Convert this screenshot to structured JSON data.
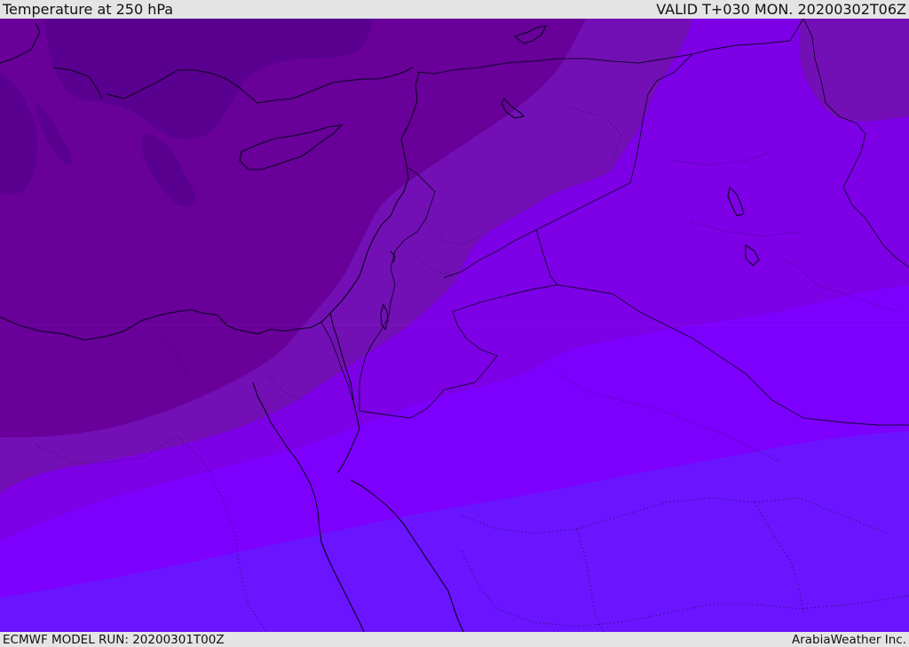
{
  "header": {
    "title": "Temperature at 250 hPa",
    "valid": "VALID T+030 MON. 20200302T06Z"
  },
  "footer": {
    "model_run": "ECMWF MODEL RUN: 20200301T00Z",
    "credit": "ArabiaWeather Inc."
  },
  "colors": {
    "band_darkest": "#5a0090",
    "band_dark": "#680099",
    "band_mid": "#7310b5",
    "band_violet": "#7d00e6",
    "band_bright": "#7d00ff",
    "band_blue": "#6a14ff",
    "boundary_lines": "#0a0420"
  }
}
